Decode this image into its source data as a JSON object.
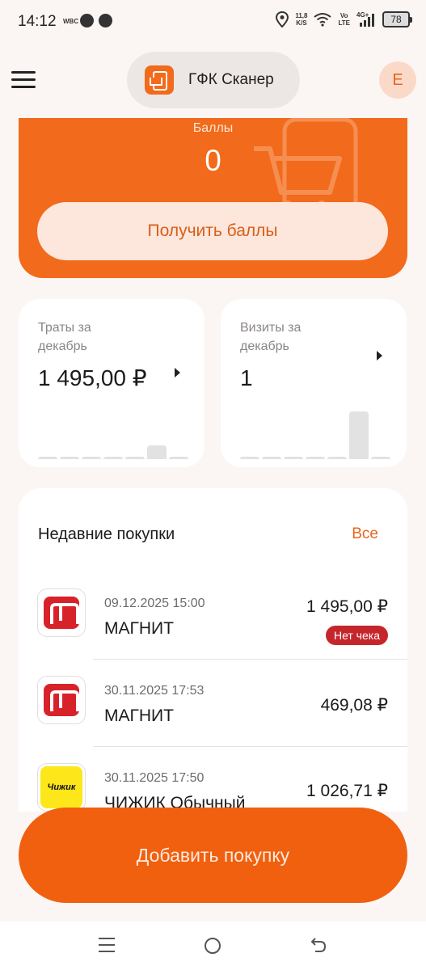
{
  "status_bar": {
    "time": "14:12",
    "small_label": "WBC",
    "speed": "11,8",
    "speed_unit": "K/S",
    "volte_top": "Vo",
    "volte_bottom": "LTE",
    "network": "4G+",
    "battery": "78"
  },
  "header": {
    "title": "ГФК Сканер",
    "avatar_letter": "E"
  },
  "points": {
    "label": "Баллы",
    "value": "0",
    "button_label": "Получить баллы"
  },
  "stats": {
    "spending": {
      "label": "Траты за декабрь",
      "value": "1 495,00 ₽",
      "bars": [
        0,
        0,
        0,
        0,
        0,
        0.24,
        0
      ]
    },
    "visits": {
      "label": "Визиты за декабрь",
      "value": "1",
      "bars": [
        0,
        0,
        0,
        0,
        0,
        0.85,
        0
      ]
    }
  },
  "recent": {
    "title": "Недавние покупки",
    "all_label": "Все",
    "items": [
      {
        "date": "09.12.2025 15:00",
        "store": "МАГНИТ",
        "amount": "1 495,00 ₽",
        "badge": "Нет чека",
        "logo": "magnit-logo"
      },
      {
        "date": "30.11.2025 17:53",
        "store": "МАГНИТ",
        "amount": "469,08 ₽",
        "logo": "magnit-logo"
      },
      {
        "date": "30.11.2025 17:50",
        "store": "ЧИЖИК Обычный",
        "amount": "1 026,71 ₽",
        "logo": "chizhik-logo",
        "logo_text": "Чижик"
      }
    ]
  },
  "add_button_label": "Добавить покупку",
  "colors": {
    "accent": "#f26a1b",
    "badge": "#c5262c",
    "background": "#fbf6f4"
  }
}
